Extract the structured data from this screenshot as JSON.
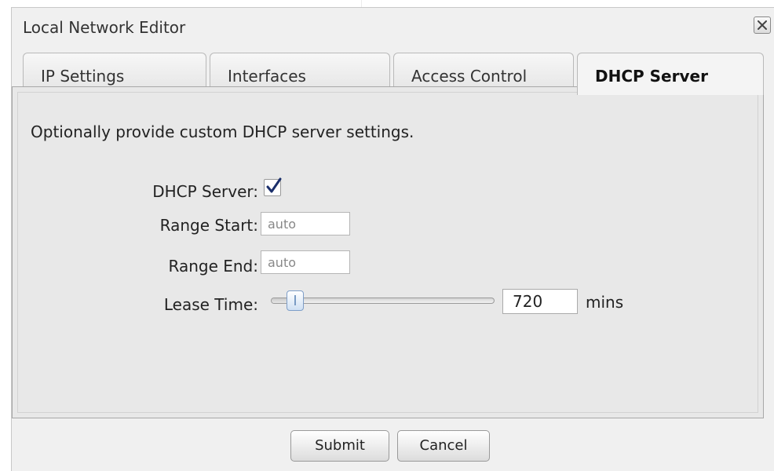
{
  "dialog": {
    "title": "Local Network Editor",
    "close_icon": "close-icon"
  },
  "tabs": [
    {
      "label": "IP Settings",
      "active": false
    },
    {
      "label": "Interfaces",
      "active": false
    },
    {
      "label": "Access Control",
      "active": false
    },
    {
      "label": "DHCP Server",
      "active": true
    }
  ],
  "panel": {
    "intro": "Optionally provide custom DHCP server settings.",
    "dhcp_server": {
      "label": "DHCP Server:",
      "checked": true
    },
    "range_start": {
      "label": "Range Start:",
      "placeholder": "auto",
      "value": ""
    },
    "range_end": {
      "label": "Range End:",
      "placeholder": "auto",
      "value": ""
    },
    "lease_time": {
      "label": "Lease Time:",
      "value": "720",
      "unit": "mins",
      "slider_fraction": 0.11
    }
  },
  "buttons": {
    "submit": "Submit",
    "cancel": "Cancel"
  },
  "colors": {
    "dialog_bg": "#f0f0f0",
    "panel_bg": "#e8e8e8",
    "slider_thumb": "#cfe0f3"
  }
}
